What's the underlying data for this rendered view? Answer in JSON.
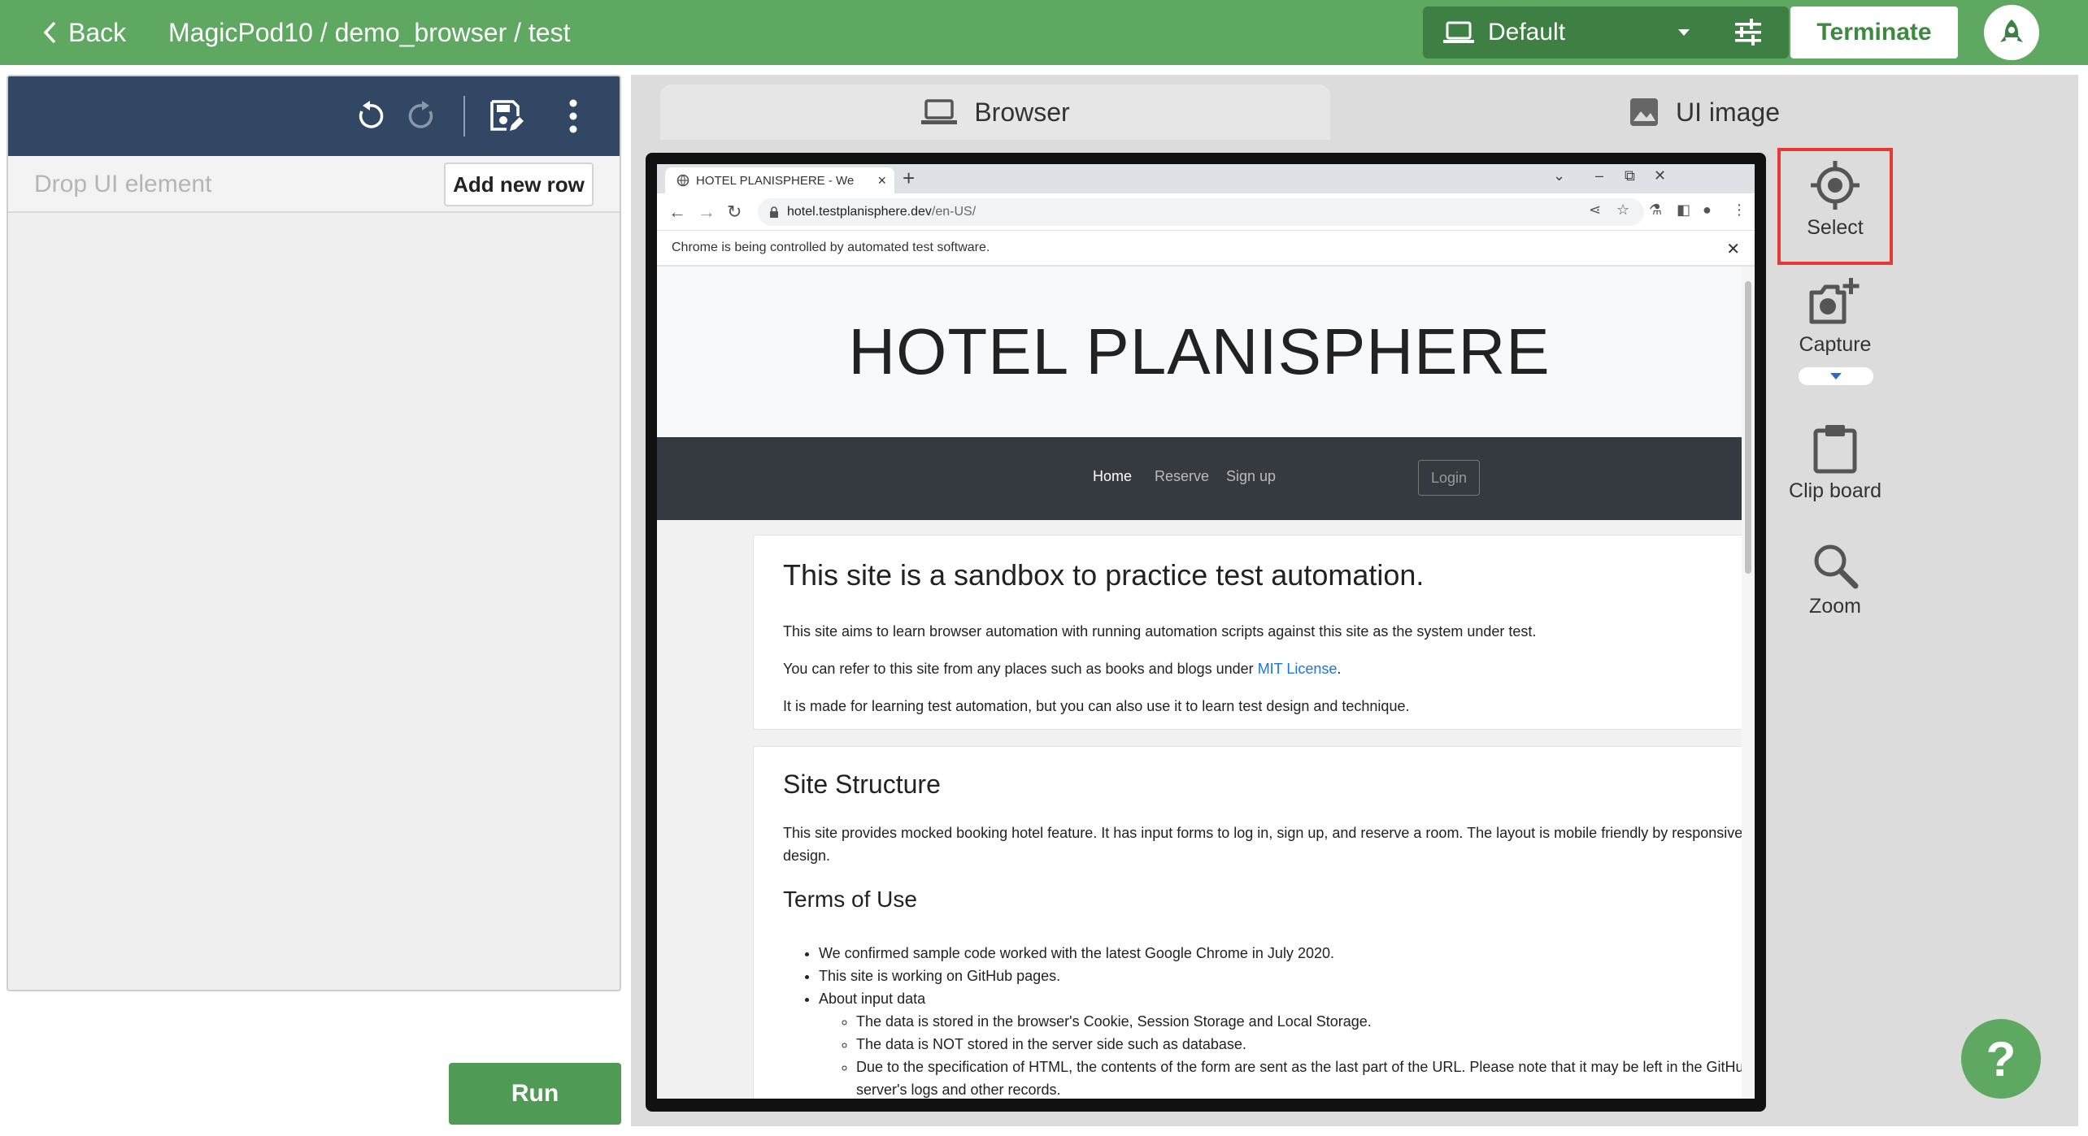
{
  "header": {
    "back_label": "Back",
    "breadcrumb": "MagicPod10 / demo_browser / test",
    "device": "Default",
    "terminate_label": "Terminate"
  },
  "left_panel": {
    "drop_placeholder": "Drop UI element",
    "add_row_label": "Add new row",
    "run_label": "Run"
  },
  "tabs": {
    "browser": "Browser",
    "ui_image": "UI image"
  },
  "chrome": {
    "tab_title": "HOTEL PLANISPHERE - We",
    "url_host": "hotel.testplanisphere.dev",
    "url_path": "/en-US/",
    "info_message": "Chrome is being controlled by automated test software."
  },
  "website": {
    "title": "HOTEL PLANISPHERE",
    "nav": [
      "Home",
      "Reserve",
      "Sign up"
    ],
    "login": "Login",
    "card1": {
      "heading": "This site is a sandbox to practice test automation.",
      "p1": "This site aims to learn browser automation with running automation scripts against this site as the system under test.",
      "p2_before": "You can refer to this site from any places such as books and blogs under ",
      "p2_link": "MIT License",
      "p2_after": ".",
      "p3": "It is made for learning test automation, but you can also use it to learn test design and technique."
    },
    "card2": {
      "heading": "Site Structure",
      "p1": "This site provides mocked booking hotel feature. It has input forms to log in, sign up, and reserve a room. The layout is mobile friendly by responsive design.",
      "subheading": "Terms of Use",
      "items": [
        "We confirmed sample code worked with the latest Google Chrome in July 2020.",
        "This site is working on GitHub pages.",
        "About input data"
      ],
      "subitems": [
        "The data is stored in the browser's Cookie, Session Storage and Local Storage.",
        "The data is NOT stored in the server side such as database.",
        "Due to the specification of HTML, the contents of the form are sent as the last part of the URL. Please note that it may be left in the GitHub server's logs and other records."
      ]
    }
  },
  "tools": {
    "select": "Select",
    "capture": "Capture",
    "clipboard": "Clip board",
    "zoom": "Zoom"
  },
  "help": "?"
}
